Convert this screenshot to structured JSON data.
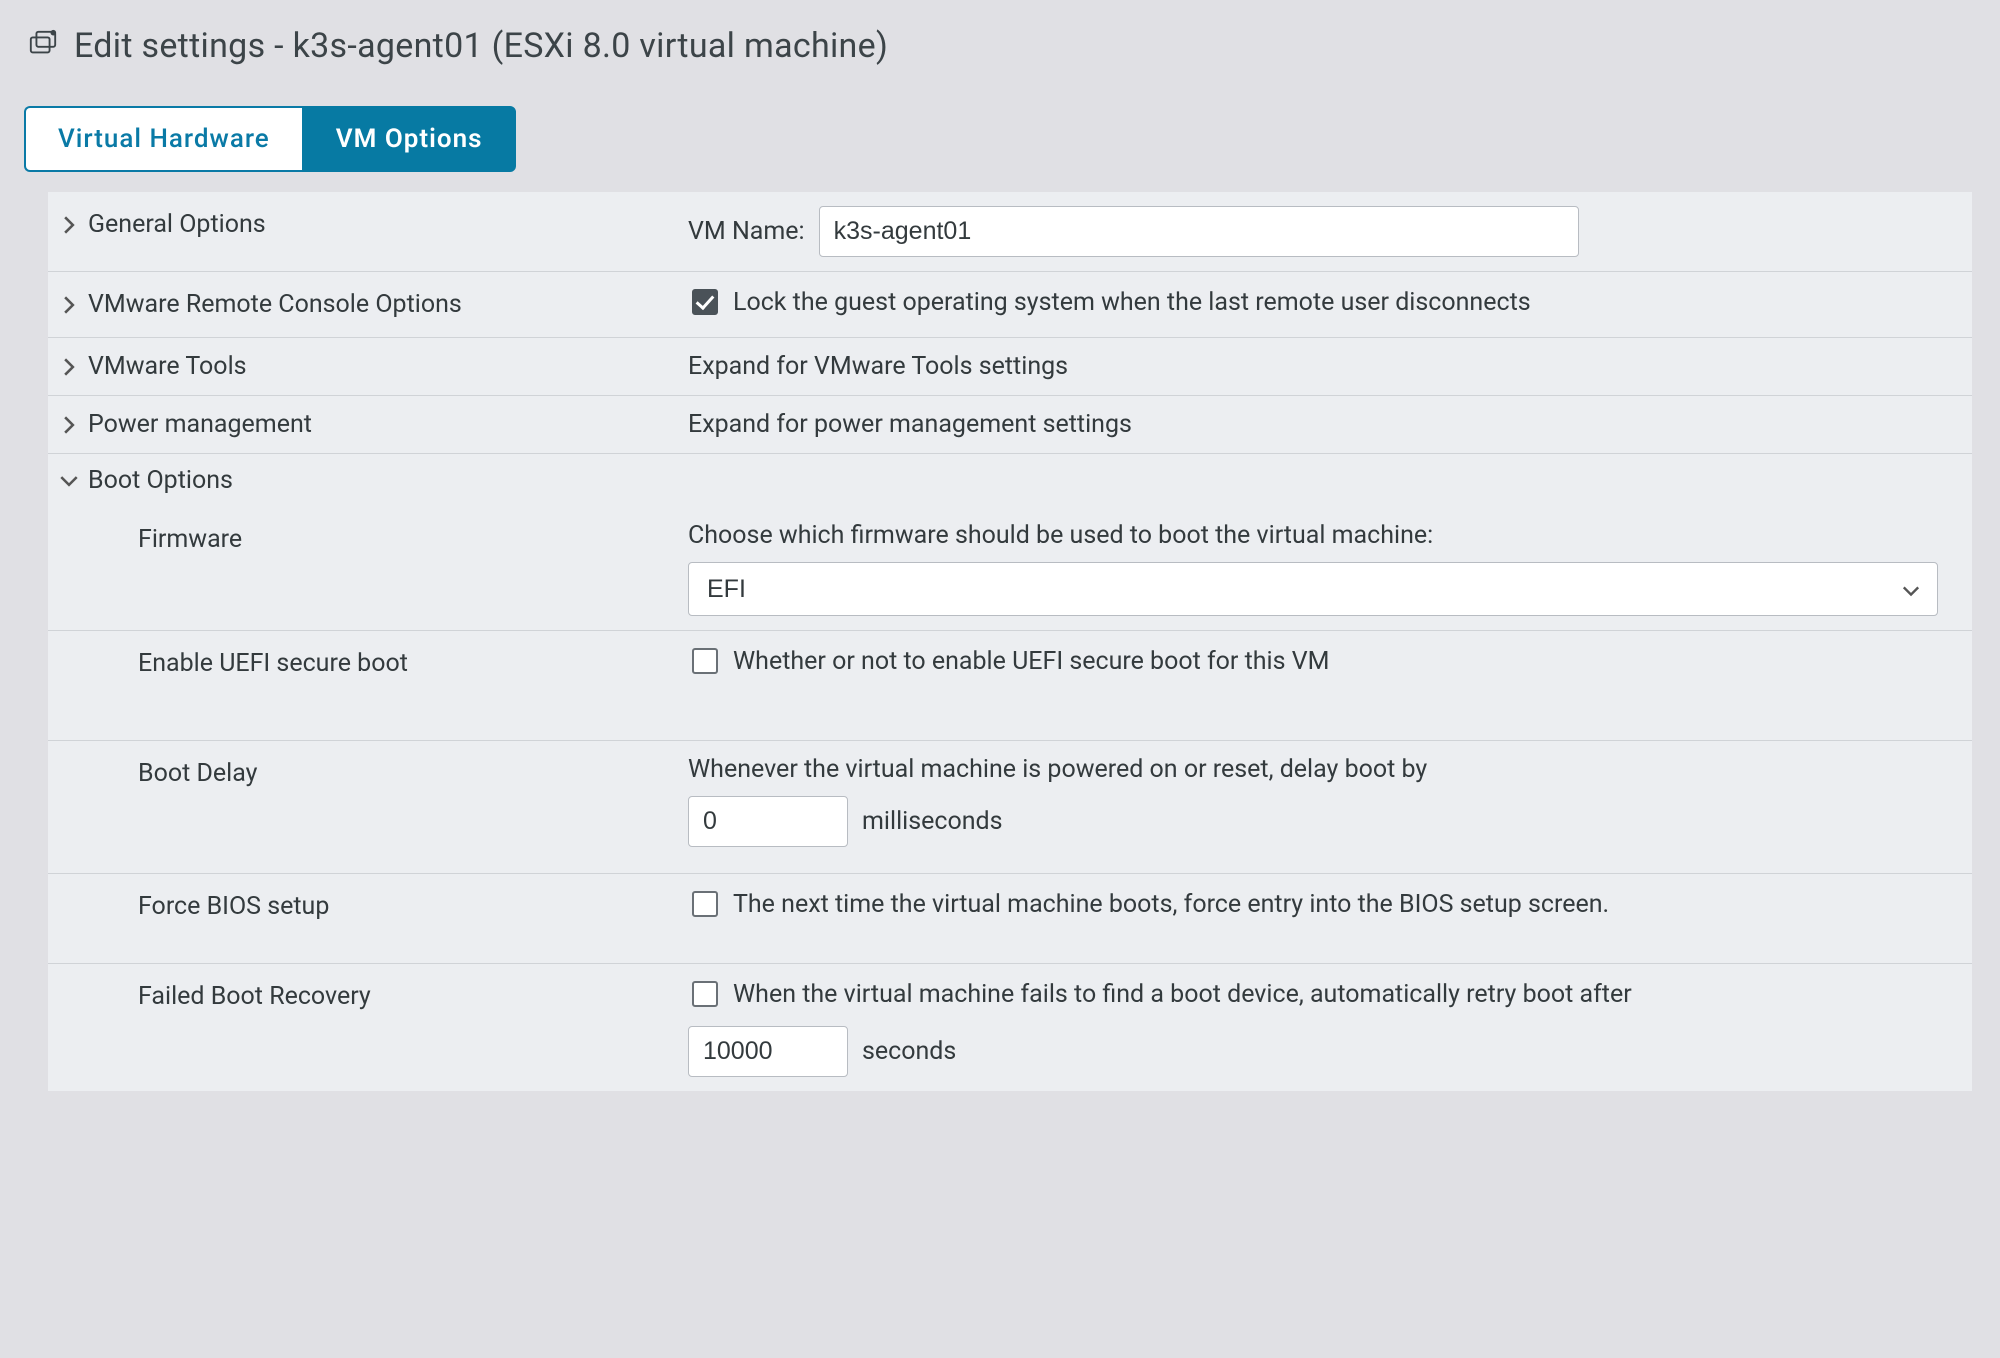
{
  "header": {
    "title": "Edit settings - k3s-agent01 (ESXi 8.0 virtual machine)"
  },
  "tabs": {
    "virtual_hardware": "Virtual Hardware",
    "vm_options": "VM Options"
  },
  "sections": {
    "general": {
      "label": "General Options",
      "vm_name_label": "VM Name:",
      "vm_name_value": "k3s-agent01"
    },
    "remote_console": {
      "label": "VMware Remote Console Options",
      "lock_label": "Lock the guest operating system when the last remote user disconnects",
      "lock_checked": "true"
    },
    "vmware_tools": {
      "label": "VMware Tools",
      "summary": "Expand for VMware Tools settings"
    },
    "power_mgmt": {
      "label": "Power management",
      "summary": "Expand for power management settings"
    },
    "boot": {
      "label": "Boot Options",
      "firmware": {
        "label": "Firmware",
        "desc": "Choose which firmware should be used to boot the virtual machine:",
        "value": "EFI"
      },
      "secure_boot": {
        "label": "Enable UEFI secure boot",
        "desc": "Whether or not to enable UEFI secure boot for this VM"
      },
      "boot_delay": {
        "label": "Boot Delay",
        "desc": "Whenever the virtual machine is powered on or reset, delay boot by",
        "value": "0",
        "unit": "milliseconds"
      },
      "force_bios": {
        "label": "Force BIOS setup",
        "desc": "The next time the virtual machine boots, force entry into the BIOS setup screen."
      },
      "failed_boot": {
        "label": "Failed Boot Recovery",
        "desc": "When the virtual machine fails to find a boot device, automatically retry boot after",
        "value": "10000",
        "unit": "seconds"
      }
    }
  }
}
